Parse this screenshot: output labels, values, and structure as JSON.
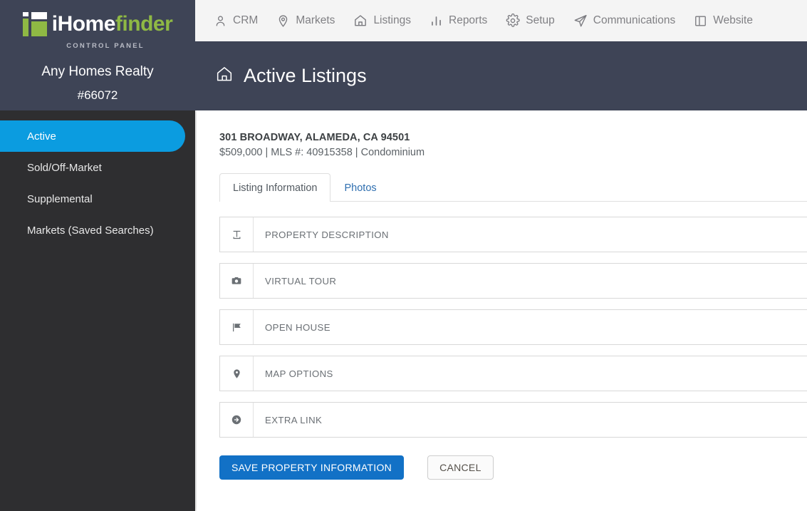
{
  "brand": {
    "logo_text_part1": "iHome",
    "logo_text_part2": "finder",
    "logo_subtitle": "CONTROL PANEL",
    "green": "#8fb944",
    "header_bg": "#3e4456",
    "accent_blue": "#0b9ce0",
    "button_blue": "#1271c6"
  },
  "account": {
    "name": "Any Homes Realty",
    "id": "#66072"
  },
  "sidebar": {
    "items": [
      {
        "label": "Active",
        "active": true
      },
      {
        "label": "Sold/Off-Market",
        "active": false
      },
      {
        "label": "Supplemental",
        "active": false
      },
      {
        "label": "Markets (Saved Searches)",
        "active": false
      }
    ]
  },
  "topnav": {
    "items": [
      {
        "label": "CRM",
        "icon": "person-icon"
      },
      {
        "label": "Markets",
        "icon": "map-pin-icon"
      },
      {
        "label": "Listings",
        "icon": "home-icon"
      },
      {
        "label": "Reports",
        "icon": "bar-chart-icon"
      },
      {
        "label": "Setup",
        "icon": "gear-icon"
      },
      {
        "label": "Communications",
        "icon": "paper-plane-icon"
      },
      {
        "label": "Website",
        "icon": "columns-icon"
      }
    ]
  },
  "page_header": {
    "icon": "home-icon",
    "title": "Active Listings"
  },
  "listing": {
    "address": "301 BROADWAY, ALAMEDA, CA 94501",
    "meta": "$509,000 | MLS #: 40915358 | Condominium"
  },
  "tabs": [
    {
      "label": "Listing Information",
      "active": true
    },
    {
      "label": "Photos",
      "active": false
    }
  ],
  "sections": [
    {
      "label": "PROPERTY DESCRIPTION",
      "icon": "text-format-icon"
    },
    {
      "label": "VIRTUAL TOUR",
      "icon": "camera-icon"
    },
    {
      "label": "OPEN HOUSE",
      "icon": "flag-icon"
    },
    {
      "label": "MAP OPTIONS",
      "icon": "map-pin-icon"
    },
    {
      "label": "EXTRA LINK",
      "icon": "arrow-circle-right-icon"
    }
  ],
  "buttons": {
    "save": "SAVE PROPERTY INFORMATION",
    "cancel": "CANCEL"
  }
}
